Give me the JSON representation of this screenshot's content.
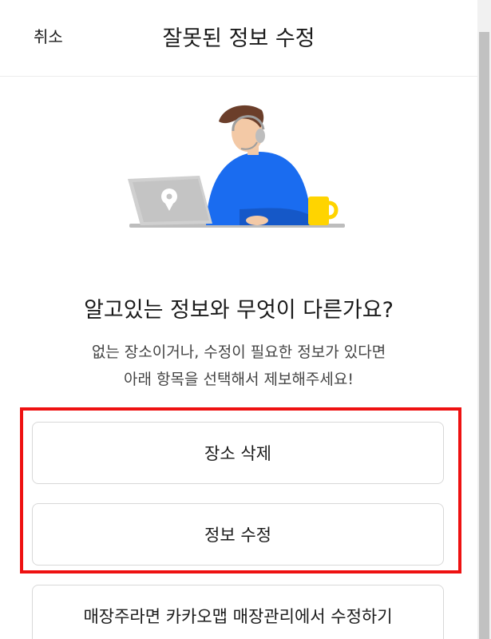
{
  "header": {
    "cancel_label": "취소",
    "title": "잘못된 정보 수정"
  },
  "main": {
    "heading": "알고있는 정보와 무엇이 다른가요?",
    "subtext_line1": "없는 장소이거나, 수정이 필요한 정보가 있다면",
    "subtext_line2": "아래 항목을 선택해서 제보해주세요!"
  },
  "options": {
    "delete_label": "장소 삭제",
    "edit_label": "정보 수정",
    "owner_label": "매장주라면 카카오맵 매장관리에서 수정하기"
  },
  "colors": {
    "highlight": "#ee1111",
    "shirt": "#1a6cf0",
    "mug": "#ffd400"
  }
}
